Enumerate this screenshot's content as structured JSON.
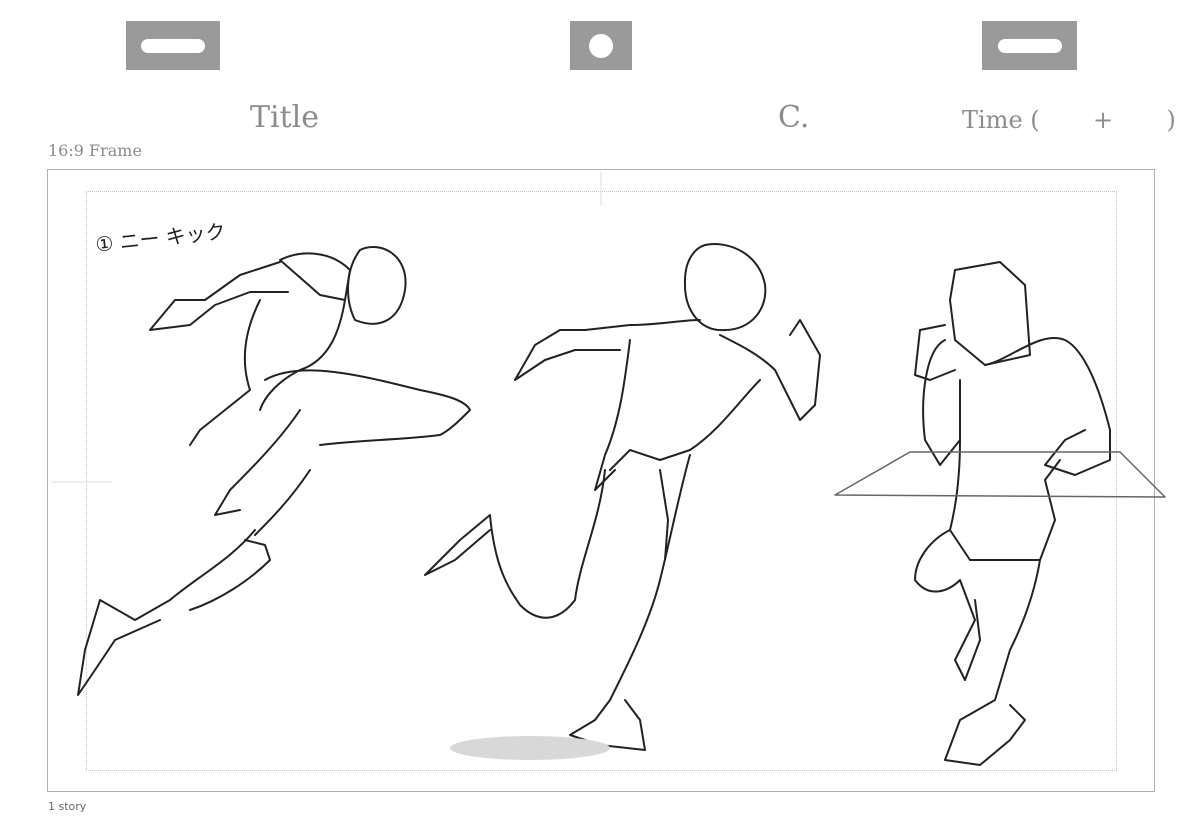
{
  "header": {
    "title_label": "Title",
    "cut_label": "C.",
    "time_label": "Time (       +       )"
  },
  "frame": {
    "label": "16:9 Frame"
  },
  "footer": {
    "story_label": "1 story"
  },
  "annotation": {
    "number": "①",
    "text": "ニー キック"
  }
}
